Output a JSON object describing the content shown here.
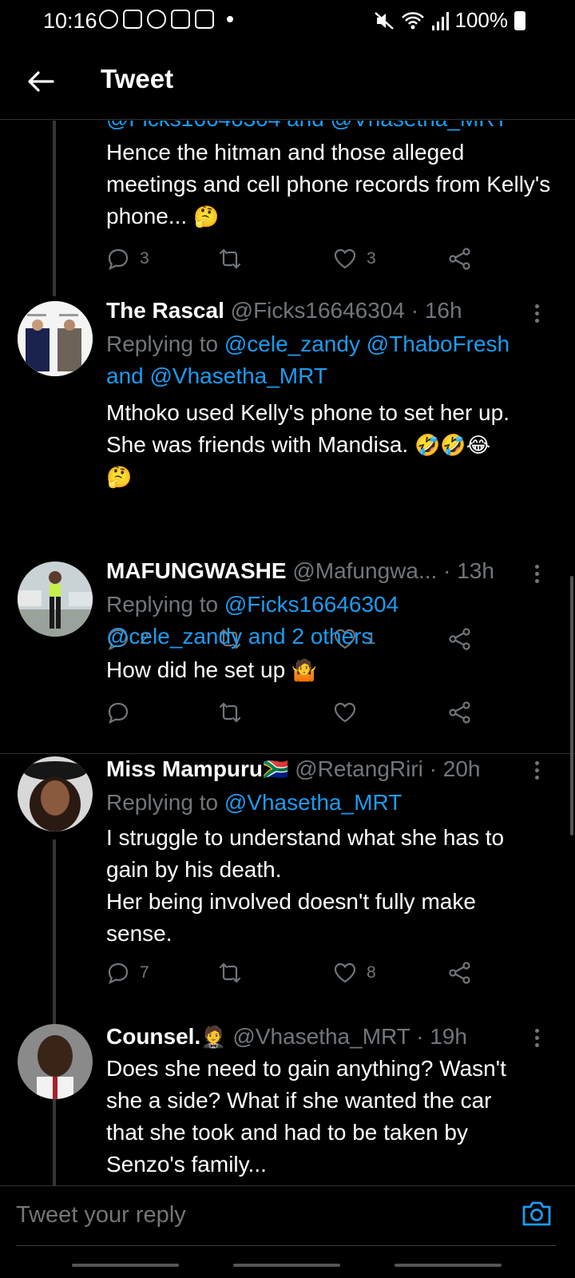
{
  "status_bar": {
    "time": "10:16",
    "battery": "100%"
  },
  "header": {
    "title": "Tweet"
  },
  "top_partial": {
    "clipped_line": "@Ficks16646304 and @Vhasetha_MRT",
    "body": "Hence the hitman and those alleged meetings and cell phone records from Kelly's phone...",
    "emoji": "🤔",
    "replies": "3",
    "likes": "3"
  },
  "tweets": [
    {
      "name": "The Rascal",
      "handle": "@Ficks16646304",
      "time": "16h",
      "replying_prefix": "Replying to",
      "replying_to": "@cele_zandy @ThaboFresh",
      "replying_to_2": "and @Vhasetha_MRT",
      "body_1": "Mthoko used Kelly's phone to set her up.",
      "body_2": "She was friends with Mandisa.",
      "emoji_1": "🤣🤣😂",
      "emoji_2": "🤔",
      "replies": "2",
      "likes": "1"
    },
    {
      "name": "MAFUNGWASHE",
      "handle": "@Mafungwa...",
      "time": "13h",
      "replying_prefix": "Replying to",
      "replying_to": "@Ficks16646304",
      "replying_to_2": "@cele_zandy and 2 others",
      "body_1": "How did he set up",
      "emoji_1": "🤷"
    },
    {
      "name": "Miss Mampuru",
      "name_flag": "🇿🇦",
      "handle": "@RetangRiri",
      "time": "20h",
      "replying_prefix": "Replying to",
      "replying_to": "@Vhasetha_MRT",
      "body_1": "I struggle to understand what she has to",
      "body_2": "gain by his death.",
      "body_3": "Her being involved doesn't fully make",
      "body_4": "sense.",
      "replies": "7",
      "likes": "8"
    },
    {
      "name": "Counsel.",
      "name_emoji": "🤵",
      "handle": "@Vhasetha_MRT",
      "time": "19h",
      "body_1": "Does she need to gain anything? Wasn't",
      "body_2": "she a side? What if she wanted the car",
      "body_3": "that she took and had to be taken by",
      "body_4": "Senzo's family..."
    }
  ],
  "composer": {
    "placeholder": "Tweet your reply"
  },
  "colors": {
    "background": "#000000",
    "link": "#1d9bf0",
    "muted": "#71767b",
    "divider": "#2f3336"
  }
}
